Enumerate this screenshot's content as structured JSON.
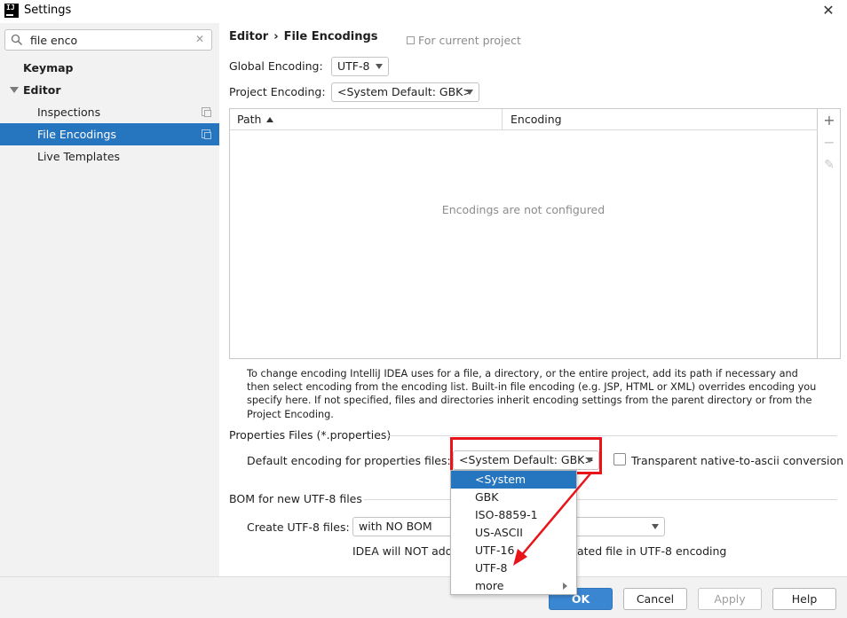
{
  "window": {
    "app_icon_text": "IJ",
    "title": "Settings",
    "close_glyph": "✕"
  },
  "sidebar": {
    "search": {
      "value": "file enco",
      "clear_glyph": "✕"
    },
    "items": [
      {
        "label": "Keymap"
      },
      {
        "label": "Editor"
      },
      {
        "label": "Inspections"
      },
      {
        "label": "File Encodings"
      },
      {
        "label": "Live Templates"
      }
    ]
  },
  "header": {
    "crumb_parent": "Editor",
    "crumb_sep": "›",
    "crumb_current": "File Encodings",
    "scope": "For current project"
  },
  "global_encoding": {
    "label": "Global Encoding:",
    "value": "UTF-8"
  },
  "project_encoding": {
    "label": "Project Encoding:",
    "value": "<System Default: GBK>"
  },
  "table": {
    "columns": [
      "Path",
      "Encoding"
    ],
    "empty_text": "Encodings are not configured",
    "tools": {
      "add": "+",
      "remove": "−",
      "edit": "✎"
    }
  },
  "help_text": "To change encoding IntelliJ IDEA uses for a file, a directory, or the entire project, add its path if necessary and then select encoding from the encoding list. Built-in file encoding (e.g. JSP, HTML or XML) overrides encoding you specify here. If not specified, files and directories inherit encoding settings from the parent directory or from the Project Encoding.",
  "properties": {
    "section_title": "Properties Files (*.properties)",
    "default_label": "Default encoding for properties files:",
    "default_value": "<System Default: GBK>",
    "transparent_label": "Transparent native-to-ascii conversion",
    "dropdown_options": [
      "<System Default>",
      "GBK",
      "ISO-8859-1",
      "US-ASCII",
      "UTF-16",
      "UTF-8",
      "more"
    ]
  },
  "bom": {
    "section_title": "BOM for new UTF-8 files",
    "create_label": "Create UTF-8 files:",
    "create_value": "with NO BOM",
    "note_left": "IDEA will NOT add",
    "note_right": "ated file in UTF-8 encoding"
  },
  "buttons": {
    "ok": "OK",
    "cancel": "Cancel",
    "apply": "Apply",
    "help": "Help"
  },
  "colors": {
    "selection": "#2675bf",
    "highlight_red": "#e8141a",
    "primary_button": "#3a86d1",
    "sidebar_bg": "#f2f2f2"
  },
  "icons": {
    "search": "search-icon",
    "copy": "copy-icon",
    "expand": "triangle-down-icon",
    "submenu": "chevron-right-icon"
  }
}
